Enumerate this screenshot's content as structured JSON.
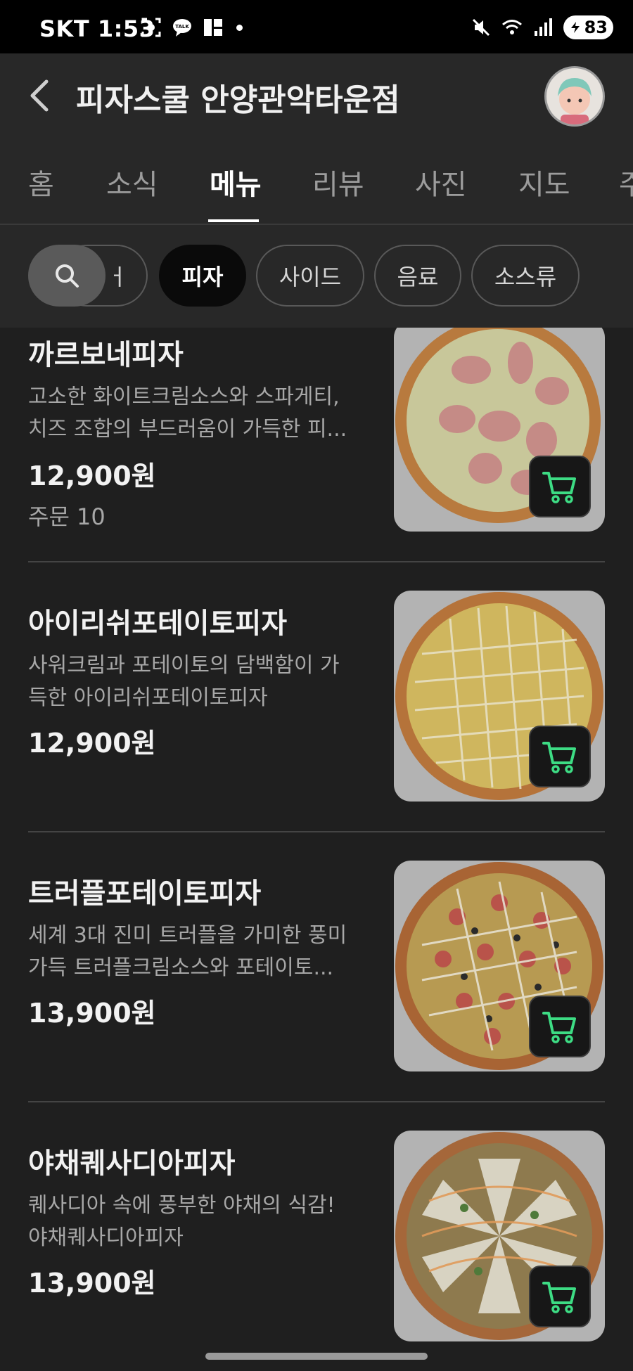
{
  "status_bar": {
    "carrier_time": "SKT 1:53",
    "battery": "83"
  },
  "header": {
    "store_name": "피자스쿨 안양관악타운점"
  },
  "tabs": [
    {
      "label": "홈"
    },
    {
      "label": "소식"
    },
    {
      "label": "메뉴",
      "active": true
    },
    {
      "label": "리뷰"
    },
    {
      "label": "사진"
    },
    {
      "label": "지도"
    },
    {
      "label": "주"
    }
  ],
  "category_chips": [
    {
      "label": "세트 메뉴",
      "visible_label": "ㅓ"
    },
    {
      "label": "피자",
      "active": true
    },
    {
      "label": "사이드"
    },
    {
      "label": "음료"
    },
    {
      "label": "소스류"
    }
  ],
  "menu_items": [
    {
      "name": "까르보네피자",
      "desc_lines": [
        "고소한 화이트크림소스와 스파게티,",
        "치즈 조합의 부드러움이 가득한 피..."
      ],
      "price": "12,900원",
      "orders": "주문 10"
    },
    {
      "name": "아이리쉬포테이토피자",
      "desc_lines": [
        "사워크림과 포테이토의 담백함이 가",
        "득한 아이리쉬포테이토피자"
      ],
      "price": "12,900원"
    },
    {
      "name": "트러플포테이토피자",
      "desc_lines": [
        "세계 3대 진미 트러플을 가미한 풍미",
        "가득 트러플크림소스와 포테이토..."
      ],
      "price": "13,900원"
    },
    {
      "name": "야채퀘사디아피자",
      "desc_lines": [
        "퀘사디아 속에 풍부한 야채의 식감!",
        "야채퀘사디아피자"
      ],
      "price": "13,900원"
    }
  ],
  "colors": {
    "background": "#1f1f1f",
    "header": "#282828",
    "cart_icon": "#3ddc84"
  }
}
